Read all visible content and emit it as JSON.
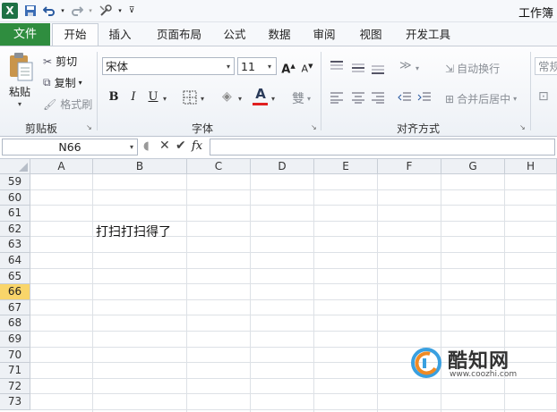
{
  "window": {
    "title": "工作簿"
  },
  "qat": {
    "app_icon": "X",
    "undo_icon": "undo-icon",
    "redo_icon": "redo-icon"
  },
  "tabs": [
    {
      "label": "文件"
    },
    {
      "label": "开始"
    },
    {
      "label": "插入"
    },
    {
      "label": "页面布局"
    },
    {
      "label": "公式"
    },
    {
      "label": "数据"
    },
    {
      "label": "审阅"
    },
    {
      "label": "视图"
    },
    {
      "label": "开发工具"
    }
  ],
  "ribbon": {
    "clipboard": {
      "paste": "粘贴",
      "cut": "剪切",
      "copy": "复制",
      "format_painter": "格式刷",
      "label": "剪贴板"
    },
    "font": {
      "name": "宋体",
      "size": "11",
      "bold": "B",
      "italic": "I",
      "underline": "U",
      "label": "字体",
      "font_color": "#e02020"
    },
    "alignment": {
      "wrap": "自动换行",
      "merge": "合并后居中",
      "label": "对齐方式"
    },
    "number": {
      "format": "常规"
    }
  },
  "formula_bar": {
    "name_box": "N66",
    "fx": "fx",
    "value": ""
  },
  "grid": {
    "columns": [
      "A",
      "B",
      "C",
      "D",
      "E",
      "F",
      "G",
      "H"
    ],
    "rows": [
      "59",
      "60",
      "61",
      "62",
      "63",
      "64",
      "65",
      "66",
      "67",
      "68",
      "69",
      "70",
      "71",
      "72",
      "73"
    ],
    "active_row": "66",
    "cells": {
      "B62": "打扫打扫得了"
    }
  },
  "watermark": {
    "brand": "酷知网",
    "url": "www.coozhi.com"
  }
}
